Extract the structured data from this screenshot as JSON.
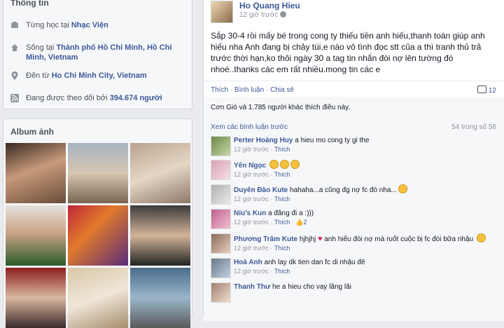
{
  "info": {
    "title": "Thông tin",
    "rows": [
      {
        "icon": "education-icon",
        "prefix": "Từng học tại ",
        "link": "Nhạc Viện"
      },
      {
        "icon": "home-icon",
        "prefix": "Sống tại ",
        "link": "Thành phố Hồ Chí Minh, Hồ Chí Minh, Vietnam"
      },
      {
        "icon": "location-icon",
        "prefix": "Đến từ ",
        "link": "Ho Chi Minh City, Vietnam"
      },
      {
        "icon": "rss-icon",
        "prefix": "Đang được theo dõi bởi ",
        "link": "394.674 người"
      }
    ]
  },
  "album": {
    "title": "Album ảnh"
  },
  "post": {
    "author": "Ho Quang Hieu",
    "time": "12 giờ trước",
    "text": "Sắp 30-4 rồi mấy bé trong cong ty thiếu tiền anh hiếu,thanh toán giúp anh hiếu nha Anh đang bị chảy túi,e nào vô tình đọc stt của a thì tranh thủ trả trước thời hạn,ko thôi ngày 30 a tag tin nhắn đòi nợ lên tường đó nhoé..thanks các em rất nhiều.mong tin các e",
    "actions": {
      "like": "Thích",
      "comment": "Bình luận",
      "share": "Chia sẻ",
      "sep": " · "
    },
    "comment_count": "12",
    "likes_text": "Cơn Gió và 1.785 người khác thích điều này.",
    "prev_comments": "Xem các bình luận trước",
    "pager": "54 trong số 58"
  },
  "comments": [
    {
      "name": "Perter Hoàng Huy",
      "text": " a hieu mo cong ty gi the",
      "time": "12 giờ trước",
      "like": "Thích"
    },
    {
      "name": "Yến Ngọc",
      "text": "",
      "time": "12 giờ trước",
      "like": "Thích"
    },
    {
      "name": "Duyên Đào Kute",
      "text": " hahaha...a cũng đg nợ fc đó nha...",
      "time": "12 giờ trước",
      "like": "Thích"
    },
    {
      "name": "Niu's Kun",
      "text": " a đăng đi a :)))",
      "time": "12 giờ trước",
      "like": "Thích",
      "likes": "2"
    },
    {
      "name": "Phương Trâm Kute",
      "text": " hjhjhj ",
      "text2": " anh hiếu đòi nợ mà ruốt cuộc bị fc đòi bữa nhậu",
      "time": "12 giờ trước",
      "like": "Thích"
    },
    {
      "name": "Hoà Anh",
      "text": " anh lay dk tien dan fc di nhậu đê",
      "time": "12 giờ trước",
      "like": "Thích"
    },
    {
      "name": "Thanh Thư",
      "text": " he a hieu cho vay lãng lãi",
      "time": "",
      "like": ""
    }
  ]
}
